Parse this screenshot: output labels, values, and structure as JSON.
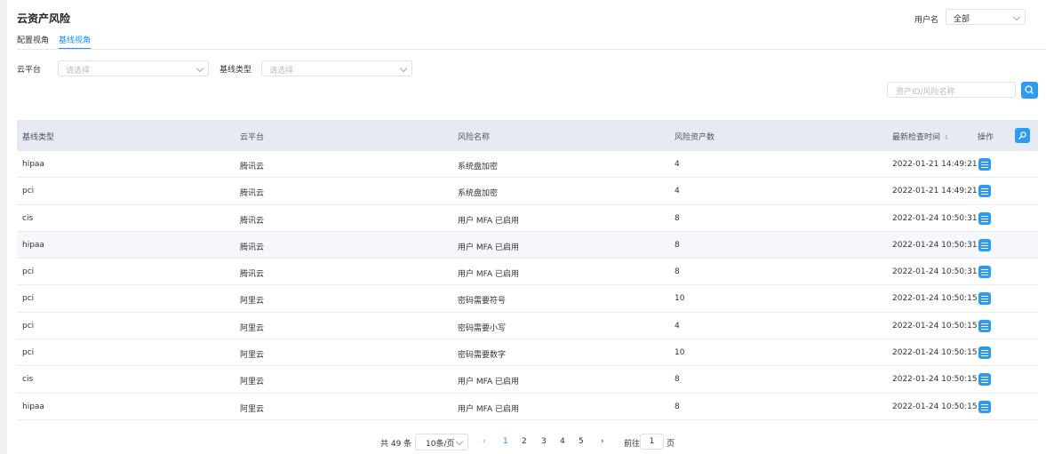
{
  "header": {
    "title": "云资产风险",
    "user_label": "用户名",
    "user_value": "全部"
  },
  "tabs": [
    {
      "label": "配置视角"
    },
    {
      "label": "基线视角"
    }
  ],
  "filters": {
    "cloud_label": "云平台",
    "cloud_placeholder": "请选择",
    "baseline_label": "基线类型",
    "baseline_placeholder": "请选择",
    "search_placeholder": "资产ID/风险名称"
  },
  "table": {
    "columns": [
      "基线类型",
      "云平台",
      "风险名称",
      "风险资产数",
      "最新检查时间",
      "操作"
    ],
    "rows": [
      [
        "hipaa",
        "腾讯云",
        "系统盘加密",
        "4",
        "2022-01-21 14:49:21"
      ],
      [
        "pci",
        "腾讯云",
        "系统盘加密",
        "4",
        "2022-01-21 14:49:21"
      ],
      [
        "cis",
        "腾讯云",
        "用户 MFA 已启用",
        "8",
        "2022-01-24 10:50:31"
      ],
      [
        "hipaa",
        "腾讯云",
        "用户 MFA 已启用",
        "8",
        "2022-01-24 10:50:31"
      ],
      [
        "pci",
        "腾讯云",
        "用户 MFA 已启用",
        "8",
        "2022-01-24 10:50:31"
      ],
      [
        "pci",
        "阿里云",
        "密码需要符号",
        "10",
        "2022-01-24 10:50:15"
      ],
      [
        "pci",
        "阿里云",
        "密码需要小写",
        "4",
        "2022-01-24 10:50:15"
      ],
      [
        "pci",
        "阿里云",
        "密码需要数字",
        "10",
        "2022-01-24 10:50:15"
      ],
      [
        "cis",
        "阿里云",
        "用户 MFA 已启用",
        "8",
        "2022-01-24 10:50:15"
      ],
      [
        "hipaa",
        "阿里云",
        "用户 MFA 已启用",
        "8",
        "2022-01-24 10:50:15"
      ]
    ]
  },
  "pagination": {
    "total_text": "共 49 条",
    "page_size": "10条/页",
    "pages": [
      "1",
      "2",
      "3",
      "4",
      "5"
    ],
    "current_page": "1",
    "goto_label": "前往",
    "goto_value": "1",
    "page_suffix": "页"
  },
  "colors": {
    "accent": "#1890ff",
    "button": "#2d9bf0",
    "header_bg": "#e6ebf3"
  }
}
